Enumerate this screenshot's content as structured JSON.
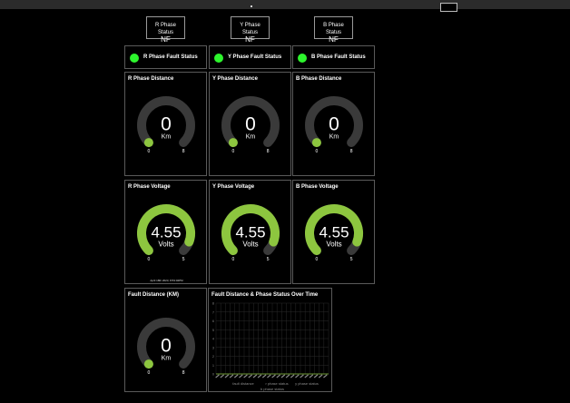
{
  "status_boxes": [
    {
      "title": "R Phase Status",
      "value": "NF"
    },
    {
      "title": "Y Phase Status",
      "value": "NF"
    },
    {
      "title": "B Phase Status",
      "value": "NF"
    }
  ],
  "fault_status": [
    {
      "label": "R Phase Fault Status",
      "color": "#2df52d"
    },
    {
      "label": "Y Phase Fault Status",
      "color": "#2df52d"
    },
    {
      "label": "B Phase Fault Status",
      "color": "#2df52d"
    }
  ],
  "distance_gauges": [
    {
      "title": "R Phase Distance",
      "value": "0",
      "unit": "Km",
      "min": "0",
      "max": "8",
      "level": 0
    },
    {
      "title": "Y Phase Distance",
      "value": "0",
      "unit": "Km",
      "min": "0",
      "max": "8",
      "level": 0
    },
    {
      "title": "B Phase Distance",
      "value": "0",
      "unit": "Km",
      "min": "0",
      "max": "8",
      "level": 0
    }
  ],
  "voltage_gauges": [
    {
      "title": "R Phase Voltage",
      "value": "4.55",
      "unit": "Volts",
      "min": "0",
      "max": "5",
      "level": 0.91,
      "timestamp": "April 18th 2023, 8:53:02PM"
    },
    {
      "title": "Y Phase Voltage",
      "value": "4.55",
      "unit": "Volts",
      "min": "0",
      "max": "5",
      "level": 0.91
    },
    {
      "title": "B Phase Voltage",
      "value": "4.55",
      "unit": "Volts",
      "min": "0",
      "max": "5",
      "level": 0.91
    }
  ],
  "fault_distance": {
    "title": "Fault Distance (KM)",
    "value": "0",
    "unit": "Km",
    "min": "0",
    "max": "8",
    "level": 0
  },
  "chart_panel": {
    "title": "Fault Distance & Phase Status Over Time",
    "y_ticks": [
      "8",
      "7",
      "6",
      "5",
      "4",
      "3",
      "2",
      "1",
      "0"
    ],
    "legend": [
      "fault distance",
      "r phase status",
      "y phase status",
      "b phase status"
    ]
  },
  "colors": {
    "accent": "#8dc63f",
    "track": "#3a3a3a",
    "dot": "#2df52d"
  }
}
